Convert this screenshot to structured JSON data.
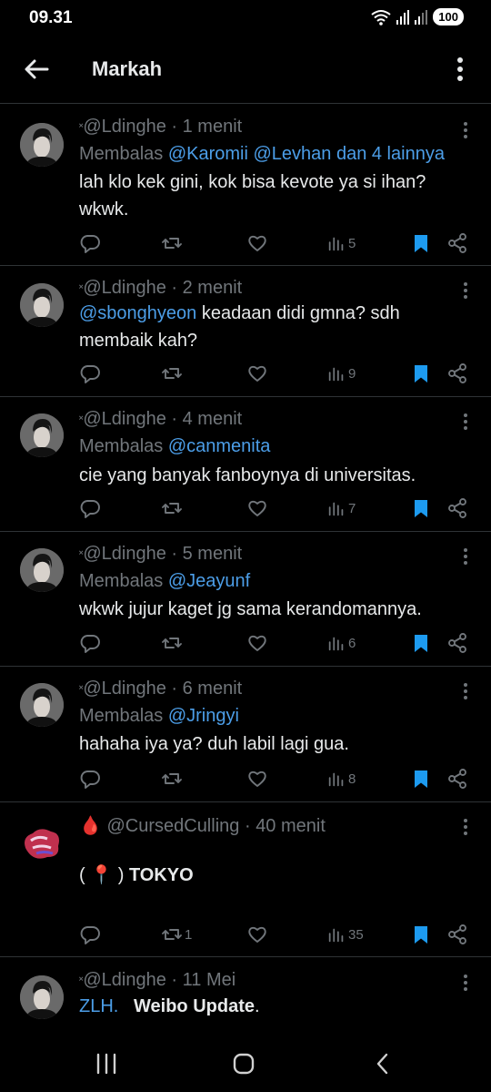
{
  "status": {
    "time": "09.31",
    "battery": "100"
  },
  "header": {
    "title": "Markah"
  },
  "tweets": [
    {
      "handle": "@Ldinghe",
      "sep": "·",
      "time": "1 menit",
      "reply_prefix": "Membalas",
      "reply_to": "@Karomii @Levhan dan 4 lainnya",
      "text": "lah klo kek gini, kok bisa kevote ya si ihan? wkwk.",
      "retweets": "",
      "views": "5"
    },
    {
      "handle": "@Ldinghe",
      "sep": "·",
      "time": "2 menit",
      "mention": "@sbonghyeon",
      "text": " keadaan didi gmna? sdh membaik kah?",
      "retweets": "",
      "views": "9"
    },
    {
      "handle": "@Ldinghe",
      "sep": "·",
      "time": "4 menit",
      "reply_prefix": "Membalas",
      "reply_to": "@canmenita",
      "text": "cie yang banyak fanboynya di universitas.",
      "retweets": "",
      "views": "7"
    },
    {
      "handle": "@Ldinghe",
      "sep": "·",
      "time": "5 menit",
      "reply_prefix": "Membalas",
      "reply_to": "@Jeayunf",
      "text": "wkwk jujur kaget jg sama kerandomannya.",
      "retweets": "",
      "views": "6"
    },
    {
      "handle": "@Ldinghe",
      "sep": "·",
      "time": "6 menit",
      "reply_prefix": "Membalas",
      "reply_to": "@Jringyi",
      "text": "hahaha iya ya? duh labil lagi gua.",
      "retweets": "",
      "views": "8"
    },
    {
      "name_emoji": "🩸",
      "handle": "@CursedCulling",
      "sep": "·",
      "time": "40 menit",
      "text_open": "(",
      "text_pin": "📍",
      "text_close": ")",
      "text_bold": "TOKYO",
      "retweets": "1",
      "views": "35"
    },
    {
      "handle": "@Ldinghe",
      "sep": "·",
      "time": "11 Mei",
      "link_text": "ZLH.",
      "text_bold": "Weibo Update",
      "text_after": "."
    }
  ],
  "colors": {
    "background": "#000000",
    "text": "#e7e9ea",
    "muted": "#71767b",
    "link": "#4c9ee8",
    "bookmark": "#1d9bf0"
  },
  "icons": [
    "arrow-left-icon",
    "more-vertical-icon",
    "reply-icon",
    "retweet-icon",
    "heart-icon",
    "views-icon",
    "bookmark-filled-icon",
    "share-icon",
    "wifi-icon",
    "signal-icon"
  ]
}
